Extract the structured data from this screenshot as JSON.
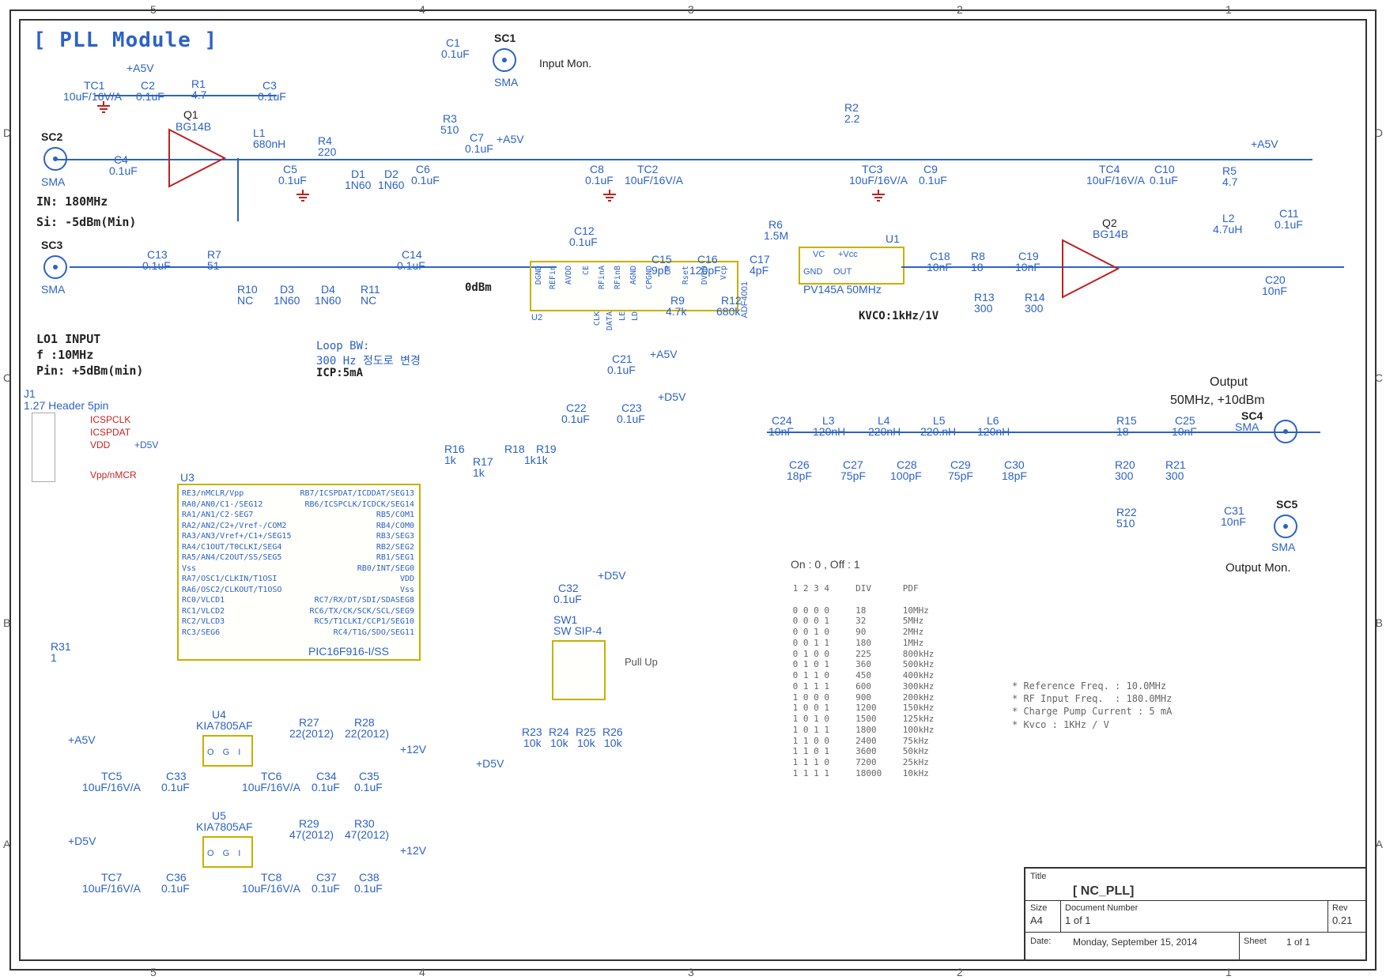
{
  "page_title": "[ PLL Module ]",
  "titleblock": {
    "title_label": "Title",
    "title": "[ NC_PLL]",
    "size_label": "Size",
    "size": "A4",
    "docnum_label": "Document Number",
    "docnum": "1 of 1",
    "rev_label": "Rev",
    "rev": "0.21",
    "date_label": "Date:",
    "date": "Monday, September 15, 2014",
    "sheet_label": "Sheet",
    "sheet_of": "1   of   1"
  },
  "grid": {
    "cols": [
      "5",
      "4",
      "3",
      "2",
      "1"
    ],
    "rows": [
      "D",
      "C",
      "B",
      "A"
    ]
  },
  "labels": {
    "input_in": "IN: 180MHz",
    "input_si": "Si: -5dBm(Min)",
    "lo1_title": "LO1 INPUT",
    "lo1_f": "f :10MHz",
    "lo1_pin": "Pin: +5dBm(min)",
    "loopbw1": "Loop BW:",
    "loopbw2": "300 Hz 정도로 변경",
    "icp": "ICP:5mA",
    "input_mon": "Input Mon.",
    "kvco": "KVCO:1kHz/1V",
    "output1": "Output",
    "output2": "50MHz, +10dBm",
    "output_mon": "Output Mon.",
    "zero_dbm": "0dBm",
    "pullup": "Pull Up",
    "onoff": "On : 0 ,  Off : 1"
  },
  "rails": {
    "p5va": "+A5V",
    "p5vd": "+D5V",
    "p12v": "+12V"
  },
  "connectors": {
    "j1_ref": "J1",
    "j1_desc": "1.27 Header 5pin",
    "j1_pins": {
      "p5": "ICSPCLK",
      "p4": "ICSPDAT",
      "p3": "VDD",
      "p2": "",
      "p1": "Vpp/nMCR"
    },
    "sc1": "SC1",
    "sc2": "SC2",
    "sc3": "SC3",
    "sc4": "SC4",
    "sc5": "SC5",
    "sma": "SMA"
  },
  "ics": {
    "q1": {
      "ref": "Q1",
      "pn": "BG14B"
    },
    "q2": {
      "ref": "Q2",
      "pn": "BG14B"
    },
    "u1": {
      "ref": "U1",
      "pn": "PV145A 50MHz",
      "pins": {
        "vc": "VC",
        "vcc": "+Vcc",
        "gnd": "GND",
        "out": "OUT"
      }
    },
    "u2": {
      "ref": "U2",
      "pn": "ADF4001",
      "vpins": [
        "DGND",
        "REFin",
        "AVDD",
        "CE",
        "RFinA",
        "RFinB",
        "AGND",
        "CPGND",
        "CP",
        "Rset",
        "DVDD",
        "Vcp"
      ],
      "hpins": [
        "CLK",
        "DATA",
        "LE",
        "LD"
      ]
    },
    "u3": {
      "ref": "U3",
      "pn": "PIC16F916-I/SS",
      "left": [
        "RE3/nMCLR/Vpp",
        "RA0/AN0/C1-/SEG12",
        "RA1/AN1/C2-SEG7",
        "RA2/AN2/C2+/Vref-/COM2",
        "RA3/AN3/Vref+/C1+/SEG15",
        "RA4/C1OUT/T0CLKI/SEG4",
        "RA5/AN4/C2OUT/SS/SEG5",
        "Vss",
        "RA7/OSC1/CLKIN/T1OSI",
        "RA6/OSC2/CLKOUT/T1OSO",
        "RC0/VLCD1",
        "RC1/VLCD2",
        "RC2/VLCD3",
        "RC3/SEG6"
      ],
      "right": [
        "RB7/ICSPDAT/ICDDAT/SEG13",
        "RB6/ICSPCLK/ICDCK/SEG14",
        "RB5/COM1",
        "RB4/COM0",
        "RB3/SEG3",
        "RB2/SEG2",
        "RB1/SEG1",
        "RB0/INT/SEG0",
        "VDD",
        "Vss",
        "RC7/RX/DT/SDI/SDASEG8",
        "RC6/TX/CK/SCK/SCL/SEG9",
        "RC5/T1CLKI/CCP1/SEG10",
        "RC4/T1G/SDO/SEG11"
      ]
    },
    "u4": {
      "ref": "U4",
      "pn": "KIA7805AF",
      "pins": "O G I"
    },
    "u5": {
      "ref": "U5",
      "pn": "KIA7805AF",
      "pins": "O G I"
    },
    "sw1": {
      "ref": "SW1",
      "pn": "SW SIP-4"
    }
  },
  "components": {
    "TC1": "10uF/16V/A",
    "C2": "0.1uF",
    "R1": "4.7",
    "C3": "0.1uF",
    "L1": "680nH",
    "R4": "220",
    "C4": "0.1uF",
    "C5": "0.1uF",
    "D1": "1N60",
    "D2": "1N60",
    "C6": "0.1uF",
    "R3": "510",
    "C7": "0.1uF",
    "C1": "0.1uF",
    "R2": "2.2",
    "C8": "0.1uF",
    "TC2": "10uF/16V/A",
    "TC3": "10uF/16V/A",
    "C9": "0.1uF",
    "TC4": "10uF/16V/A",
    "C10": "0.1uF",
    "R5": "4.7",
    "L2": "4.7uH",
    "C11": "0.1uF",
    "C13": "0.1uF",
    "R7": "51",
    "R10": "NC",
    "D3": "1N60",
    "D4": "1N60",
    "R11": "NC",
    "C14": "0.1uF",
    "C12": "0.1uF",
    "C15": "9pF",
    "C16": "120pF",
    "C17": "4pF",
    "R6": "1.5M",
    "R12": "680k",
    "R9": "4.7k",
    "C18": "10nF",
    "R8": "18",
    "C19": "10nF",
    "R13": "300",
    "R14": "300",
    "C20": "10nF",
    "C21": "0.1uF",
    "C22": "0.1uF",
    "C23": "0.1uF",
    "R16": "1k",
    "R17": "1k",
    "R18": "1k",
    "R19": "1k",
    "C24": "10nF",
    "L3": "120nH",
    "L4": "220nH",
    "L5": "220.nH",
    "L6": "120nH",
    "R15": "18",
    "C25": "10nF",
    "C26": "18pF",
    "C27": "75pF",
    "C28": "100pF",
    "C29": "75pF",
    "C30": "18pF",
    "R20": "300",
    "R21": "300",
    "R22": "510",
    "C31": "10nF",
    "C32": "0.1uF",
    "R23": "10k",
    "R24": "10k",
    "R25": "10k",
    "R26": "10k",
    "TC5": "10uF/16V/A",
    "C33": "0.1uF",
    "TC6": "10uF/16V/A",
    "C34": "0.1uF",
    "C35": "0.1uF",
    "R27": "22(2012)",
    "R28": "22(2012)",
    "TC7": "10uF/16V/A",
    "C36": "0.1uF",
    "TC8": "10uF/16V/A",
    "C37": "0.1uF",
    "C38": "0.1uF",
    "R29": "47(2012)",
    "R30": "47(2012)",
    "R31": "1"
  },
  "div_table": {
    "header": " 1 2 3 4     DIV      PDF",
    "rows": [
      " 0 0 0 0     18       10MHz",
      " 0 0 0 1     32       5MHz",
      " 0 0 1 0     90       2MHz",
      " 0 0 1 1     180      1MHz",
      " 0 1 0 0     225      800kHz",
      " 0 1 0 1     360      500kHz",
      " 0 1 1 0     450      400kHz",
      " 0 1 1 1     600      300kHz",
      " 1 0 0 0     900      200kHz",
      " 1 0 0 1     1200     150kHz",
      " 1 0 1 0     1500     125kHz",
      " 1 0 1 1     1800     100kHz",
      " 1 1 0 0     2400     75kHz",
      " 1 1 0 1     3600     50kHz",
      " 1 1 1 0     7200     25kHz",
      " 1 1 1 1     18000    10kHz"
    ]
  },
  "design_notes": [
    "* Reference Freq. : 10.0MHz",
    "* RF Input Freq.  : 180.0MHz",
    "* Charge Pump Current : 5 mA",
    "* Kvco : 1KHz / V"
  ]
}
